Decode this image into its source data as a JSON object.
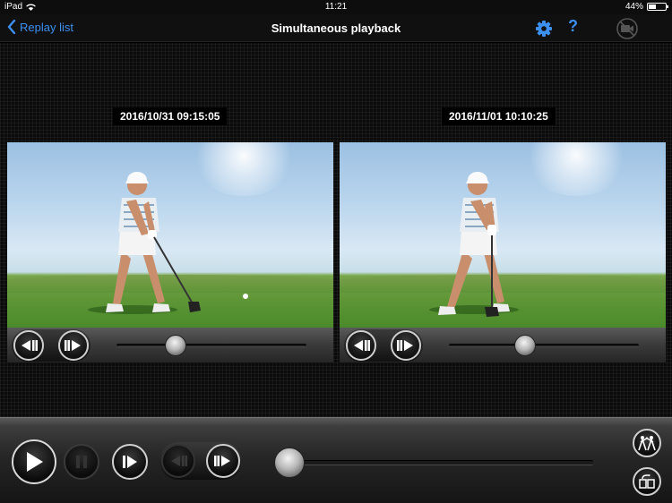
{
  "status_bar": {
    "carrier": "iPad",
    "time": "11:21",
    "battery_text": "44%",
    "battery_level": 0.44
  },
  "nav": {
    "back_label": "Replay list",
    "title": "Simultaneous playback",
    "help_label": "?",
    "accent_color": "#3d8ff0"
  },
  "players": [
    {
      "timestamp": "2016/10/31 09:15:05",
      "progress": 0.31
    },
    {
      "timestamp": "2016/11/01 10:10:25",
      "progress": 0.4
    }
  ],
  "bottom": {
    "progress": 0.03,
    "icons": [
      "play-icon",
      "pause-icon",
      "step-forward-icon",
      "step-back-icon",
      "step-forward-icon",
      "swing-compare-icon",
      "layout-toggle-icon"
    ]
  }
}
